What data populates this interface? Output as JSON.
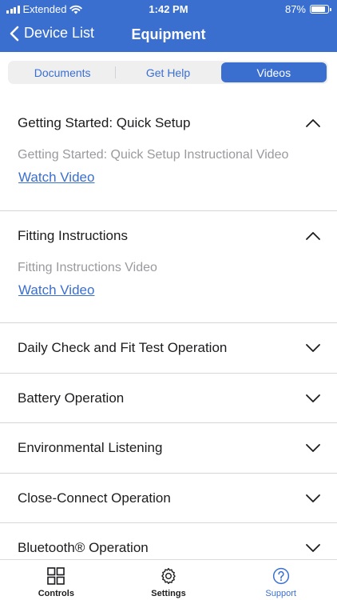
{
  "status_bar": {
    "carrier": "Extended",
    "time": "1:42 PM",
    "battery_text": "87%",
    "battery_level": 0.87
  },
  "nav": {
    "back_label": "Device List",
    "title": "Equipment"
  },
  "segments": [
    {
      "label": "Documents",
      "selected": false
    },
    {
      "label": "Get Help",
      "selected": false
    },
    {
      "label": "Videos",
      "selected": true
    }
  ],
  "videos": [
    {
      "title": "Getting Started: Quick Setup",
      "expanded": true,
      "description": "Getting Started: Quick Setup Instructional Video",
      "link": "Watch Video"
    },
    {
      "title": "Fitting Instructions",
      "expanded": true,
      "description": "Fitting Instructions Video",
      "link": "Watch Video"
    },
    {
      "title": "Daily Check and Fit Test Operation",
      "expanded": false
    },
    {
      "title": "Battery Operation",
      "expanded": false
    },
    {
      "title": "Environmental Listening",
      "expanded": false
    },
    {
      "title": "Close-Connect Operation",
      "expanded": false
    },
    {
      "title": "Bluetooth® Operation",
      "expanded": false
    }
  ],
  "tabs": [
    {
      "label": "Controls",
      "icon": "grid-icon",
      "selected": false
    },
    {
      "label": "Settings",
      "icon": "gear-icon",
      "selected": false
    },
    {
      "label": "Support",
      "icon": "question-icon",
      "selected": true
    }
  ],
  "colors": {
    "brand": "#3a6fd0",
    "muted_text": "#9a9a9e"
  }
}
